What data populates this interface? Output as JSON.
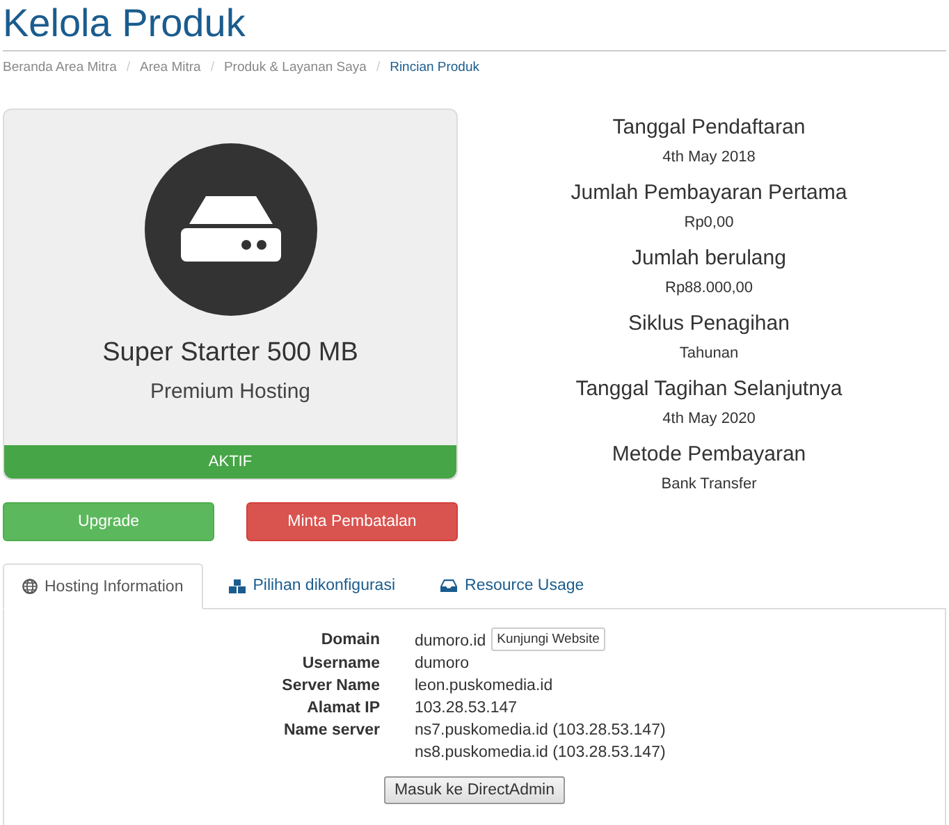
{
  "title": "Kelola Produk",
  "breadcrumb": [
    {
      "label": "Beranda Area Mitra",
      "current": false
    },
    {
      "label": "Area Mitra",
      "current": false
    },
    {
      "label": "Produk & Layanan Saya",
      "current": false
    },
    {
      "label": "Rincian Produk",
      "current": true
    }
  ],
  "separator": "/",
  "product": {
    "name": "Super Starter 500 MB",
    "group": "Premium Hosting",
    "status": "AKTIF"
  },
  "actions": [
    {
      "label": "Upgrade",
      "kind": "success"
    },
    {
      "label": "Minta Pembatalan",
      "kind": "danger"
    }
  ],
  "details": [
    {
      "label": "Tanggal Pendaftaran",
      "value": "4th May 2018"
    },
    {
      "label": "Jumlah Pembayaran Pertama",
      "value": "Rp0,00"
    },
    {
      "label": "Jumlah berulang",
      "value": "Rp88.000,00"
    },
    {
      "label": "Siklus Penagihan",
      "value": "Tahunan"
    },
    {
      "label": "Tanggal Tagihan Selanjutnya",
      "value": "4th May 2020"
    },
    {
      "label": "Metode Pembayaran",
      "value": "Bank Transfer"
    }
  ],
  "tabs": [
    {
      "label": "Hosting Information",
      "selected": true
    },
    {
      "label": "Pilihan dikonfigurasi",
      "selected": false
    },
    {
      "label": "Resource Usage",
      "selected": false
    }
  ],
  "hosting_info": [
    {
      "label": "Domain",
      "values": [
        "dumoro.id"
      ],
      "button": "Kunjungi Website"
    },
    {
      "label": "Username",
      "values": [
        "dumoro"
      ]
    },
    {
      "label": "Server Name",
      "values": [
        "leon.puskomedia.id"
      ]
    },
    {
      "label": "Alamat IP",
      "values": [
        "103.28.53.147"
      ]
    },
    {
      "label": "Name server",
      "values": [
        "ns7.puskomedia.id (103.28.53.147)",
        "ns8.puskomedia.id (103.28.53.147)"
      ]
    }
  ],
  "login_button": "Masuk ke DirectAdmin"
}
